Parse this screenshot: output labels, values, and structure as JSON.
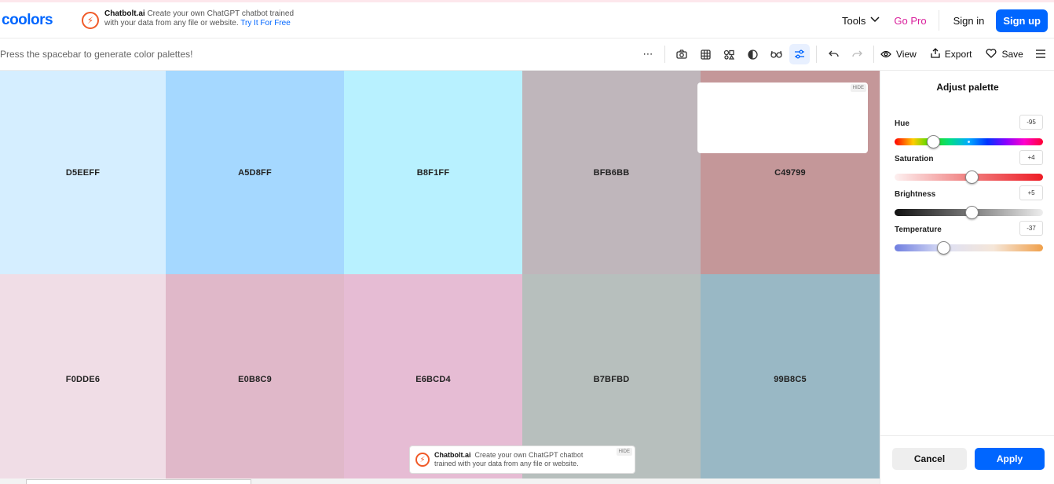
{
  "header": {
    "logo": "coolors",
    "ad": {
      "brand": "Chatbolt.ai",
      "text_line1": "Create your own ChatGPT chatbot trained",
      "text_line2": "with your data from any file or website.",
      "link": "Try It For Free"
    },
    "nav": {
      "tools": "Tools",
      "go_pro": "Go Pro",
      "sign_in": "Sign in",
      "sign_up": "Sign up"
    }
  },
  "toolbar": {
    "hint": "Press the spacebar to generate color palettes!",
    "more": "⋯",
    "icons": [
      "camera-icon",
      "grid-icon",
      "shapes-icon",
      "contrast-icon",
      "glasses-icon",
      "adjust-icon",
      "undo-icon",
      "redo-icon"
    ],
    "view_label": "View",
    "export_label": "Export",
    "save_label": "Save"
  },
  "palette": {
    "swatches": [
      {
        "hex": "D5EEFF",
        "color": "#D5EEFF"
      },
      {
        "hex": "A5D8FF",
        "color": "#A5D8FF"
      },
      {
        "hex": "B8F1FF",
        "color": "#B8F1FF"
      },
      {
        "hex": "BFB6BB",
        "color": "#BFB6BB"
      },
      {
        "hex": "C49799",
        "color": "#C49799"
      },
      {
        "hex": "F0DDE6",
        "color": "#F0DDE6"
      },
      {
        "hex": "E0B8C9",
        "color": "#E0B8C9"
      },
      {
        "hex": "E6BCD4",
        "color": "#E6BCD4"
      },
      {
        "hex": "B7BFBD",
        "color": "#B7BFBD"
      },
      {
        "hex": "99B8C5",
        "color": "#99B8C5"
      }
    ]
  },
  "ads": {
    "top_hide": "HIDE",
    "bottom": {
      "brand": "Chatbolt.ai",
      "text_line1": "Create your own ChatGPT chatbot",
      "text_line2": "trained with your data from any file or website.",
      "hide": "HIDE"
    }
  },
  "adjust_panel": {
    "title": "Adjust palette",
    "sliders": [
      {
        "label": "Hue",
        "value": "-95",
        "level": 0.26
      },
      {
        "label": "Saturation",
        "value": "+4",
        "level": 0.52
      },
      {
        "label": "Brightness",
        "value": "+5",
        "level": 0.52
      },
      {
        "label": "Temperature",
        "value": "-37",
        "level": 0.33
      }
    ],
    "cancel": "Cancel",
    "apply": "Apply"
  }
}
